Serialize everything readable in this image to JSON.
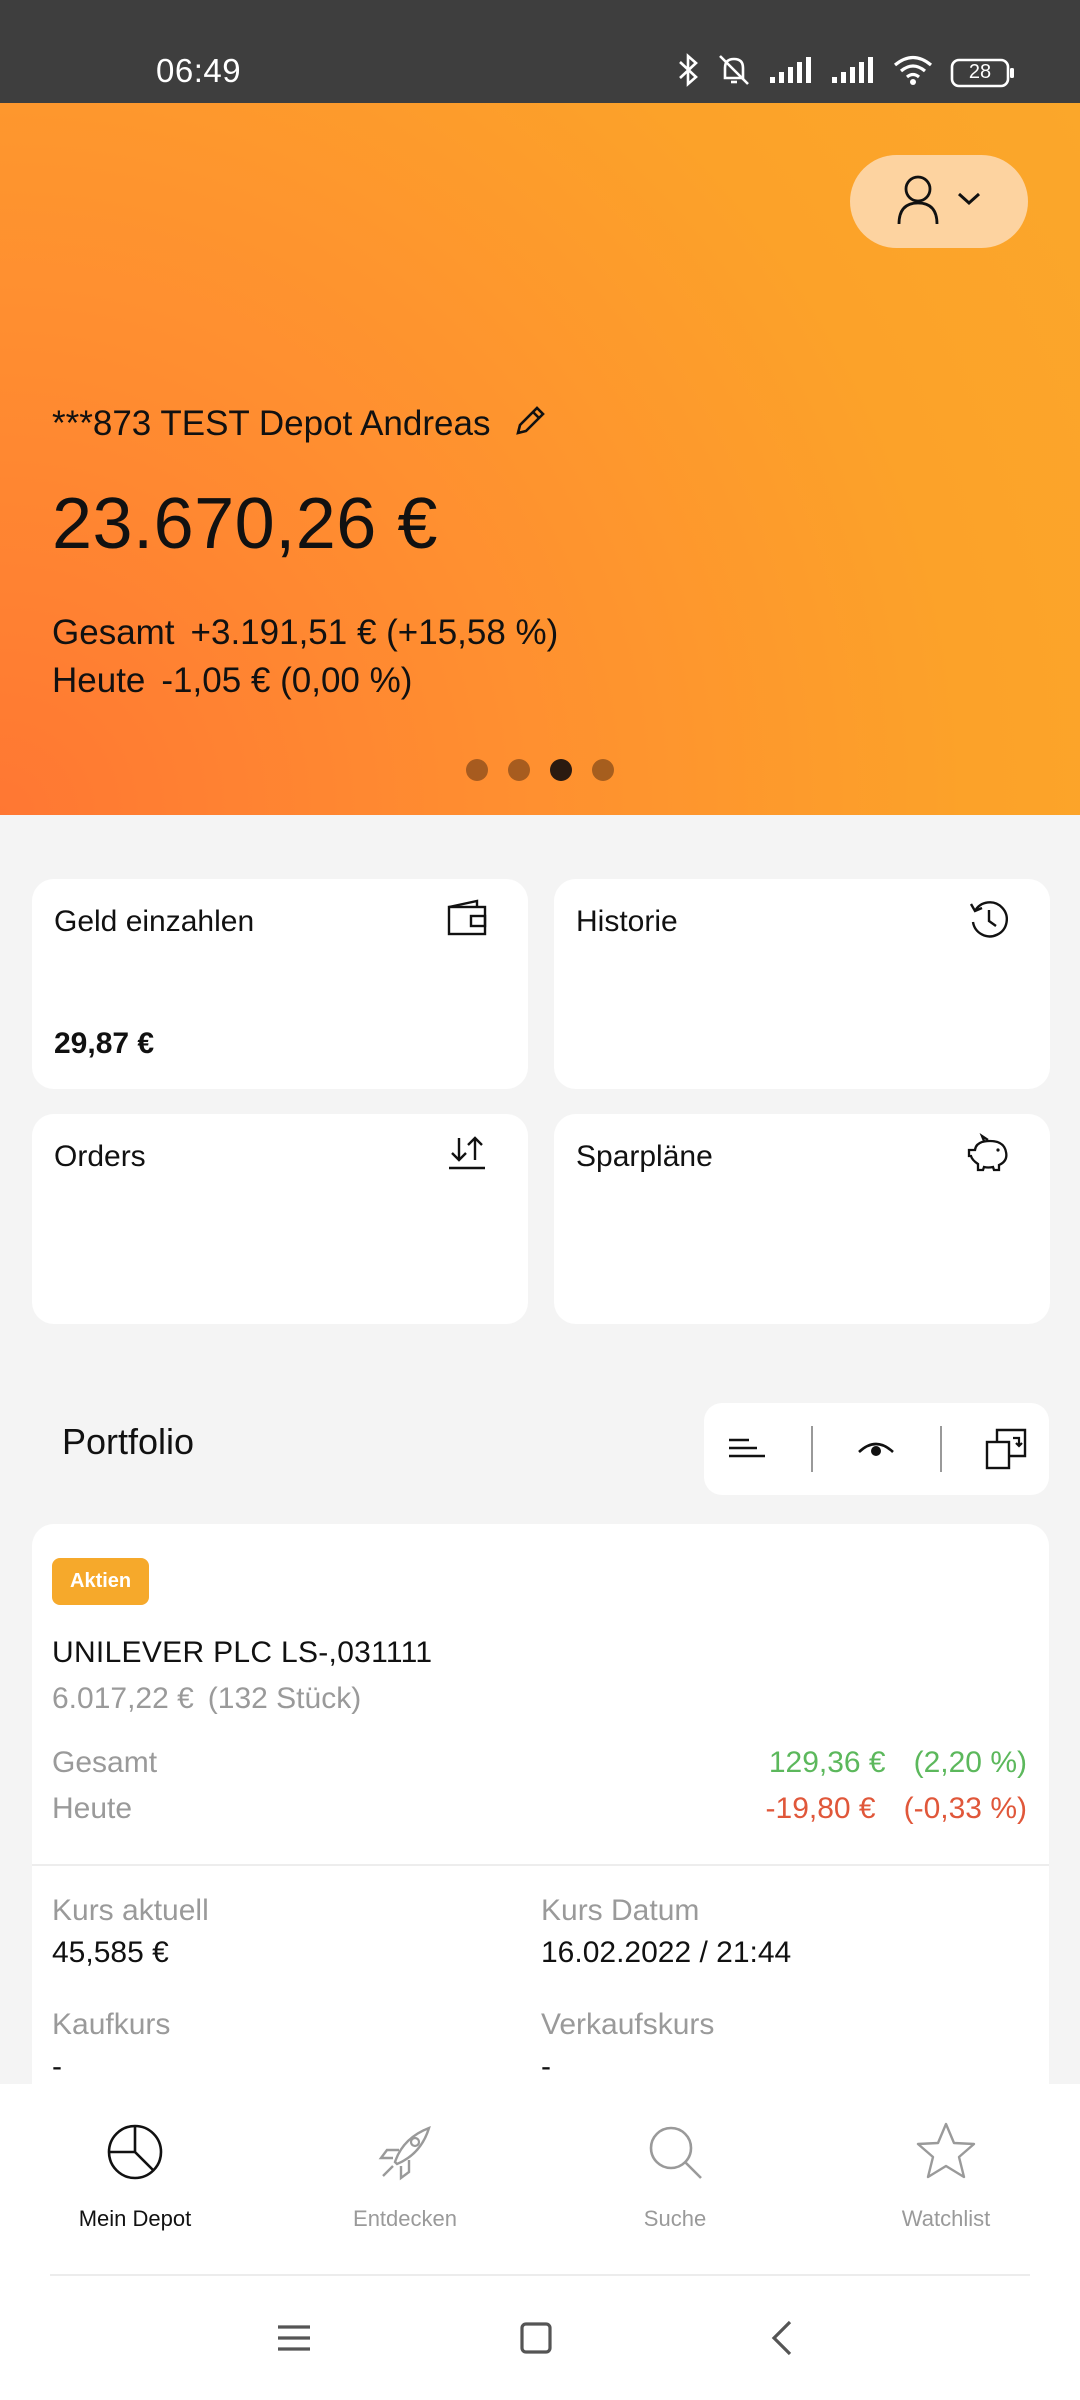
{
  "status_bar": {
    "time": "06:49",
    "battery": "28"
  },
  "hero": {
    "depot_name": "***873 TEST Depot Andreas",
    "total_value": "23.670,26 €",
    "gesamt_label": "Gesamt",
    "gesamt_value": "+3.191,51 € (+15,58 %)",
    "heute_label": "Heute",
    "heute_value": "-1,05 € (0,00 %)",
    "carousel_active_index": 3,
    "carousel_count": 4
  },
  "tiles": [
    {
      "label": "Geld einzahlen",
      "value": "29,87 €",
      "icon": "wallet-icon"
    },
    {
      "label": "Historie",
      "value": "",
      "icon": "history-icon"
    },
    {
      "label": "Orders",
      "value": "",
      "icon": "transfer-icon"
    },
    {
      "label": "Sparpläne",
      "value": "",
      "icon": "piggy-bank-icon"
    }
  ],
  "portfolio": {
    "title": "Portfolio",
    "position": {
      "badge": "Aktien",
      "name": "UNILEVER PLC LS-,031111",
      "value": "6.017,22 €",
      "quantity": "(132 Stück)",
      "gesamt_label": "Gesamt",
      "gesamt_abs": "129,36 €",
      "gesamt_pct": "(2,20 %)",
      "heute_label": "Heute",
      "heute_abs": "-19,80 €",
      "heute_pct": "(-0,33 %)",
      "kurs_aktuell_label": "Kurs aktuell",
      "kurs_aktuell_value": "45,585 €",
      "kurs_datum_label": "Kurs Datum",
      "kurs_datum_value": "16.02.2022 / 21:44",
      "kaufkurs_label": "Kaufkurs",
      "kaufkurs_value": "-",
      "verkaufskurs_label": "Verkaufskurs",
      "verkaufskurs_value": "-"
    }
  },
  "bottom_nav": [
    {
      "label": "Mein Depot",
      "icon": "pie-chart-icon",
      "active": true
    },
    {
      "label": "Entdecken",
      "icon": "rocket-icon",
      "active": false
    },
    {
      "label": "Suche",
      "icon": "search-icon",
      "active": false
    },
    {
      "label": "Watchlist",
      "icon": "star-icon",
      "active": false
    }
  ],
  "colors": {
    "accent": "#fba72a",
    "positive": "#5cb85c",
    "negative": "#e0573a",
    "badge": "#f6a92b"
  }
}
